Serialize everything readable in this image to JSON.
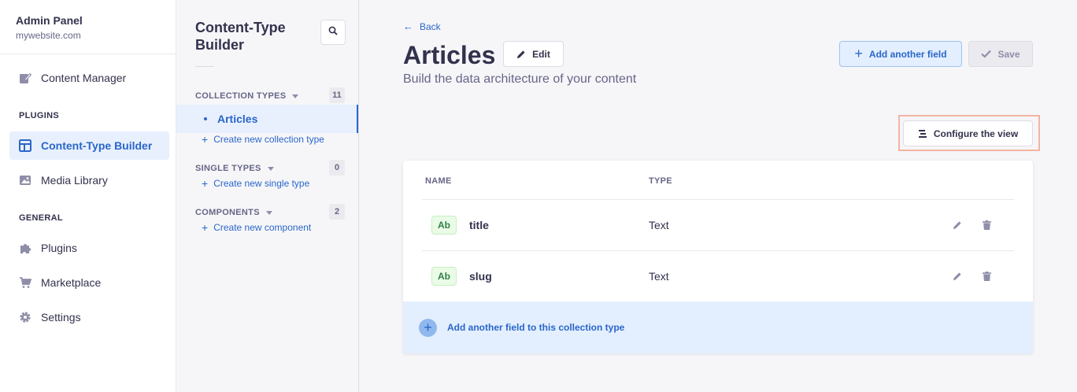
{
  "brand": {
    "title": "Admin Panel",
    "subtitle": "mywebsite.com"
  },
  "mainnav": {
    "content_manager": "Content Manager",
    "plugins_section": "PLUGINS",
    "ctb": "Content-Type Builder",
    "media_library": "Media Library",
    "general_section": "GENERAL",
    "plugins": "Plugins",
    "marketplace": "Marketplace",
    "settings": "Settings"
  },
  "subnav": {
    "title": "Content-Type Builder",
    "collection_types": {
      "label": "COLLECTION TYPES",
      "count": "11",
      "active_item": "Articles",
      "create": "Create new collection type"
    },
    "single_types": {
      "label": "SINGLE TYPES",
      "count": "0",
      "create": "Create new single type"
    },
    "components": {
      "label": "COMPONENTS",
      "count": "2",
      "create": "Create new component"
    }
  },
  "header": {
    "back": "Back",
    "title": "Articles",
    "edit": "Edit",
    "subtitle": "Build the data architecture of your content",
    "add_field": "Add another field",
    "save": "Save",
    "configure": "Configure the view"
  },
  "table": {
    "col_name": "NAME",
    "col_type": "TYPE",
    "rows": [
      {
        "badge": "Ab",
        "name": "title",
        "type": "Text"
      },
      {
        "badge": "Ab",
        "name": "slug",
        "type": "Text"
      }
    ],
    "add_bar": "Add another field to this collection type"
  },
  "colors": {
    "accent": "#2a66c9",
    "highlight": "#f3b4a2"
  }
}
